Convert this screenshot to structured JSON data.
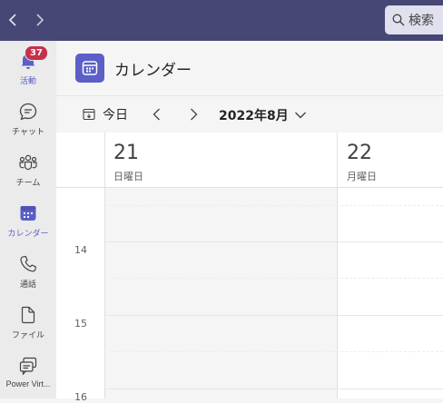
{
  "topbar": {
    "search_label": "検索"
  },
  "rail": {
    "items": [
      {
        "label": "活動",
        "badge": "37",
        "icon": "bell-icon"
      },
      {
        "label": "チャット",
        "icon": "chat-icon"
      },
      {
        "label": "チーム",
        "icon": "teams-icon"
      },
      {
        "label": "カレンダー",
        "icon": "calendar-icon"
      },
      {
        "label": "通話",
        "icon": "phone-icon"
      },
      {
        "label": "ファイル",
        "icon": "file-icon"
      },
      {
        "label": "Power Virt...",
        "icon": "power-virtual-agents-icon"
      }
    ],
    "active_index": 3
  },
  "header": {
    "title": "カレンダー"
  },
  "toolbar": {
    "today_label": "今日",
    "month_label": "2022年8月"
  },
  "days": [
    {
      "num": "21",
      "name": "日曜日"
    },
    {
      "num": "22",
      "name": "月曜日"
    }
  ],
  "hours": [
    "14",
    "15",
    "16"
  ],
  "colors": {
    "topbar": "#464775",
    "accent": "#5b5fc7",
    "badge": "#c4314b"
  }
}
